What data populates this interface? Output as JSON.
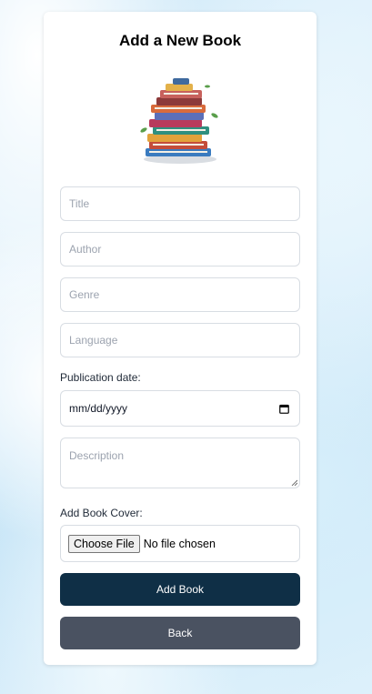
{
  "form": {
    "heading": "Add a New Book",
    "title_placeholder": "Title",
    "author_placeholder": "Author",
    "genre_placeholder": "Genre",
    "language_placeholder": "Language",
    "publication_label": "Publication date:",
    "date_placeholder": "mm/dd/yyyy",
    "description_placeholder": "Description",
    "cover_label": "Add Book Cover:",
    "choose_file_label": "Choose File",
    "file_status": "No file chosen",
    "submit_label": "Add Book",
    "back_label": "Back"
  },
  "icons": {
    "illustration": "book-stack-illustration",
    "calendar": "calendar-icon",
    "resize": "resize-grip-icon"
  },
  "colors": {
    "primary_button": "#0f2f46",
    "secondary_button": "#4a5261",
    "background": "#cfe9f8"
  }
}
